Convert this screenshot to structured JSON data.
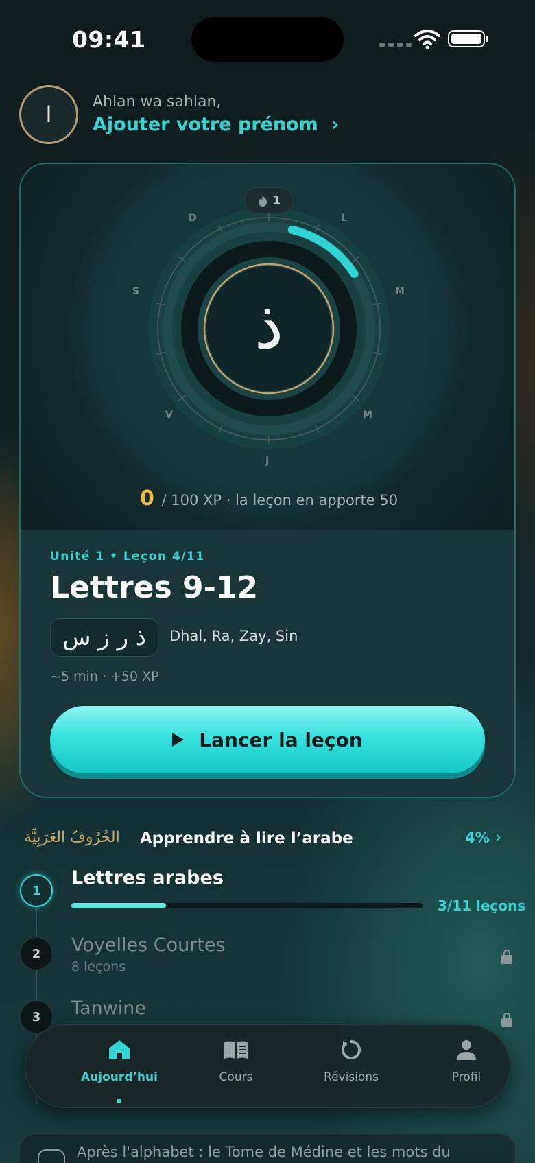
{
  "status_bar": {
    "time": "09:41"
  },
  "greeting": {
    "avatar_letter": "ا",
    "salutation": "Ahlan wa sahlan,",
    "add_name_link": "Ajouter votre prénom",
    "chevron": "›"
  },
  "hero": {
    "streak_count": "1",
    "streak_icon": "flame-icon",
    "center_letter": "ذ",
    "days": [
      "L",
      "M",
      "M",
      "J",
      "V",
      "S",
      "D"
    ],
    "xp_current": "0",
    "xp_rest": "/ 100 XP · la leçon en apporte 50",
    "xp_progress": 0.0
  },
  "lesson": {
    "unit_label": "Unité 1 • Leçon 4/11",
    "title": "Lettres 9-12",
    "letters": "ذ ر ز س",
    "letter_names": "Dhal, Ra, Zay, Sin",
    "meta": "~5 min · +50 XP",
    "start_button": "Lancer la leçon"
  },
  "course": {
    "arabic_title": "الحُرُوفُ العَرَبِيَّة",
    "title": "Apprendre à lire l’arabe",
    "percent": "4%",
    "chevron": "›",
    "modules": [
      {
        "number": "1",
        "title": "Lettres arabes",
        "count": "3/11 leçons",
        "progress": 0.27,
        "state": "active"
      },
      {
        "number": "2",
        "title": "Voyelles Courtes",
        "subtitle": "8 leçons",
        "state": "locked"
      },
      {
        "number": "3",
        "title": "Tanwine",
        "state": "locked"
      }
    ]
  },
  "tabbar": {
    "tabs": [
      {
        "label": "Aujourd’hui",
        "icon": "home-icon",
        "active": true
      },
      {
        "label": "Cours",
        "icon": "book-icon",
        "active": false
      },
      {
        "label": "Révisions",
        "icon": "refresh-icon",
        "active": false
      },
      {
        "label": "Profil",
        "icon": "person-icon",
        "active": false
      }
    ]
  },
  "teaser": {
    "text": "Après l'alphabet : le Tome de Médine et les mots du"
  },
  "colors": {
    "accent": "#36d3d3",
    "gold": "#f1b93d",
    "arabic_gold": "#c9a86e",
    "background": "#112325"
  }
}
